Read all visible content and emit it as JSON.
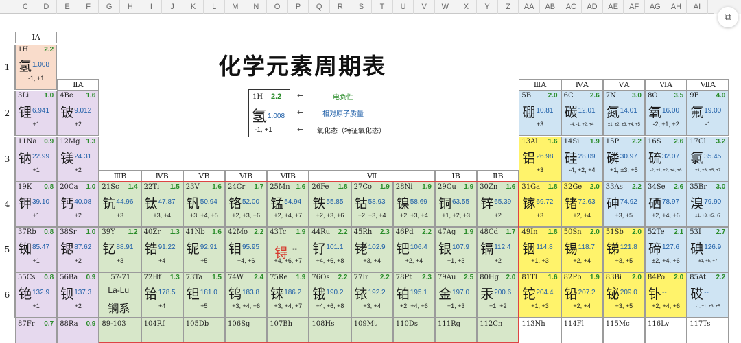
{
  "sheet": {
    "columns": [
      "C",
      "D",
      "E",
      "F",
      "G",
      "H",
      "I",
      "J",
      "K",
      "L",
      "M",
      "N",
      "O",
      "P",
      "Q",
      "R",
      "S",
      "T",
      "U",
      "V",
      "W",
      "X",
      "Y",
      "Z",
      "AA",
      "AB",
      "AC",
      "AD",
      "AE",
      "AF",
      "AG",
      "AH",
      "AI"
    ],
    "float_icon": "scan-icon"
  },
  "title": "化学元素周期表",
  "legend": {
    "zn": "1H",
    "en": "2.2",
    "cn": "氢",
    "mass": "1.008",
    "ox": "-1, +1",
    "label_en": "电负性",
    "label_mass": "相对原子质量",
    "label_ox": "氧化态（特征氧化态）",
    "colors": {
      "en": "#2a8c2a",
      "mass": "#1f5fa8"
    }
  },
  "groups": {
    "g1": "ⅠA",
    "g2": "ⅡA",
    "g3": "ⅢB",
    "g4": "ⅣB",
    "g5": "ⅤB",
    "g6": "ⅥB",
    "g7": "ⅦB",
    "g8": "Ⅶ",
    "g11": "ⅠB",
    "g12": "ⅡB",
    "g13": "ⅢA",
    "g14": "ⅣA",
    "g15": "ⅤA",
    "g16": "ⅥA",
    "g17": "ⅦA"
  },
  "periods": [
    "1",
    "2",
    "3",
    "4",
    "5",
    "6"
  ],
  "elements": [
    {
      "id": "H",
      "zn": "1H",
      "en": "2.2",
      "cn": "氢",
      "mass": "1.008",
      "ox": "-1, +1"
    },
    {
      "id": "Li",
      "zn": "3Li",
      "en": "1.0",
      "cn": "锂",
      "mass": "6.941",
      "ox": "+1"
    },
    {
      "id": "Be",
      "zn": "4Be",
      "en": "1.6",
      "cn": "铍",
      "mass": "9.012",
      "ox": "+2"
    },
    {
      "id": "Na",
      "zn": "11Na",
      "en": "0.9",
      "cn": "钠",
      "mass": "22.99",
      "ox": "+1"
    },
    {
      "id": "Mg",
      "zn": "12Mg",
      "en": "1.3",
      "cn": "镁",
      "mass": "24.31",
      "ox": "+2"
    },
    {
      "id": "K",
      "zn": "19K",
      "en": "0.8",
      "cn": "钾",
      "mass": "39.10",
      "ox": "+1"
    },
    {
      "id": "Ca",
      "zn": "20Ca",
      "en": "1.0",
      "cn": "钙",
      "mass": "40.08",
      "ox": "+2"
    },
    {
      "id": "Sc",
      "zn": "21Sc",
      "en": "1.4",
      "cn": "钪",
      "mass": "44.96",
      "ox": "+3"
    },
    {
      "id": "Ti",
      "zn": "22Ti",
      "en": "1.5",
      "cn": "钛",
      "mass": "47.87",
      "ox": "+3, +4"
    },
    {
      "id": "V",
      "zn": "23V",
      "en": "1.6",
      "cn": "钒",
      "mass": "50.94",
      "ox": "+3, +4, +5"
    },
    {
      "id": "Cr",
      "zn": "24Cr",
      "en": "1.7",
      "cn": "铬",
      "mass": "52.00",
      "ox": "+2, +3, +6"
    },
    {
      "id": "Mn",
      "zn": "25Mn",
      "en": "1.6",
      "cn": "锰",
      "mass": "54.94",
      "ox": "+2, +4, +7"
    },
    {
      "id": "Fe",
      "zn": "26Fe",
      "en": "1.8",
      "cn": "铁",
      "mass": "55.85",
      "ox": "+2, +3, +6"
    },
    {
      "id": "Co",
      "zn": "27Co",
      "en": "1.9",
      "cn": "钴",
      "mass": "58.93",
      "ox": "+2, +3, +4"
    },
    {
      "id": "Ni",
      "zn": "28Ni",
      "en": "1.9",
      "cn": "镍",
      "mass": "58.69",
      "ox": "+2, +3, +4"
    },
    {
      "id": "Cu",
      "zn": "29Cu",
      "en": "1.9",
      "cn": "铜",
      "mass": "63.55",
      "ox": "+1, +2, +3"
    },
    {
      "id": "Zn",
      "zn": "30Zn",
      "en": "1.6",
      "cn": "锌",
      "mass": "65.39",
      "ox": "+2"
    },
    {
      "id": "Rb",
      "zn": "37Rb",
      "en": "0.8",
      "cn": "铷",
      "mass": "85.47",
      "ox": "+1"
    },
    {
      "id": "Sr",
      "zn": "38Sr",
      "en": "1.0",
      "cn": "锶",
      "mass": "87.62",
      "ox": "+2"
    },
    {
      "id": "Y",
      "zn": "39Y",
      "en": "1.2",
      "cn": "钇",
      "mass": "88.91",
      "ox": "+3"
    },
    {
      "id": "Zr",
      "zn": "40Zr",
      "en": "1.3",
      "cn": "锆",
      "mass": "91.22",
      "ox": "+4"
    },
    {
      "id": "Nb",
      "zn": "41Nb",
      "en": "1.6",
      "cn": "铌",
      "mass": "92.91",
      "ox": "+5"
    },
    {
      "id": "Mo",
      "zn": "42Mo",
      "en": "2.2",
      "cn": "钼",
      "mass": "95.95",
      "ox": "+4, +6"
    },
    {
      "id": "Tc",
      "zn": "43Tc",
      "en": "1.9",
      "cn": "锝",
      "mass": "--",
      "ox": "+4, +6, +7"
    },
    {
      "id": "Ru",
      "zn": "44Ru",
      "en": "2.2",
      "cn": "钌",
      "mass": "101.1",
      "ox": "+4, +6, +8"
    },
    {
      "id": "Rh",
      "zn": "45Rh",
      "en": "2.3",
      "cn": "铑",
      "mass": "102.9",
      "ox": "+3, +4"
    },
    {
      "id": "Pd",
      "zn": "46Pd",
      "en": "2.2",
      "cn": "钯",
      "mass": "106.4",
      "ox": "+2, +4"
    },
    {
      "id": "Ag",
      "zn": "47Ag",
      "en": "1.9",
      "cn": "银",
      "mass": "107.9",
      "ox": "+1, +3"
    },
    {
      "id": "Cd",
      "zn": "48Cd",
      "en": "1.7",
      "cn": "镉",
      "mass": "112.4",
      "ox": "+2"
    },
    {
      "id": "Cs",
      "zn": "55Cs",
      "en": "0.8",
      "cn": "铯",
      "mass": "132.9",
      "ox": "+1"
    },
    {
      "id": "Ba",
      "zn": "56Ba",
      "en": "0.9",
      "cn": "钡",
      "mass": "137.3",
      "ox": "+2"
    },
    {
      "id": "La",
      "zn": "57-71",
      "en": "",
      "cn": "镧系",
      "mass": "La-Lu",
      "ox": ""
    },
    {
      "id": "Hf",
      "zn": "72Hf",
      "en": "1.3",
      "cn": "铪",
      "mass": "178.5",
      "ox": "+4"
    },
    {
      "id": "Ta",
      "zn": "73Ta",
      "en": "1.5",
      "cn": "钽",
      "mass": "181.0",
      "ox": "+5"
    },
    {
      "id": "W",
      "zn": "74W",
      "en": "2.4",
      "cn": "钨",
      "mass": "183.8",
      "ox": "+3, +4, +6"
    },
    {
      "id": "Re",
      "zn": "75Re",
      "en": "1.9",
      "cn": "铼",
      "mass": "186.2",
      "ox": "+3, +4, +7"
    },
    {
      "id": "Os",
      "zn": "76Os",
      "en": "2.2",
      "cn": "锇",
      "mass": "190.2",
      "ox": "+4, +6, +8"
    },
    {
      "id": "Ir",
      "zn": "77Ir",
      "en": "2.2",
      "cn": "铱",
      "mass": "192.2",
      "ox": "+3, +4"
    },
    {
      "id": "Pt",
      "zn": "78Pt",
      "en": "2.3",
      "cn": "铂",
      "mass": "195.1",
      "ox": "+2, +4, +6"
    },
    {
      "id": "Au",
      "zn": "79Au",
      "en": "2.5",
      "cn": "金",
      "mass": "197.0",
      "ox": "+1, +3"
    },
    {
      "id": "Hg",
      "zn": "80Hg",
      "en": "2.0",
      "cn": "汞",
      "mass": "200.6",
      "ox": "+1, +2"
    },
    {
      "id": "B",
      "zn": "5B",
      "en": "2.0",
      "cn": "硼",
      "mass": "10.81",
      "ox": "+3"
    },
    {
      "id": "C",
      "zn": "6C",
      "en": "2.6",
      "cn": "碳",
      "mass": "12.01",
      "ox": "-4, -1, +2, +4"
    },
    {
      "id": "N",
      "zn": "7N",
      "en": "3.0",
      "cn": "氮",
      "mass": "14.01",
      "ox": "±1, ±2, ±3, +4, +5"
    },
    {
      "id": "O",
      "zn": "8O",
      "en": "3.5",
      "cn": "氧",
      "mass": "16.00",
      "ox": "-2, ±1, +2"
    },
    {
      "id": "F",
      "zn": "9F",
      "en": "4.0",
      "cn": "氟",
      "mass": "19.00",
      "ox": "-1"
    },
    {
      "id": "Al",
      "zn": "13Al",
      "en": "1.6",
      "cn": "铝",
      "mass": "26.98",
      "ox": "+3"
    },
    {
      "id": "Si",
      "zn": "14Si",
      "en": "1.9",
      "cn": "硅",
      "mass": "28.09",
      "ox": "-4, +2, +4"
    },
    {
      "id": "P",
      "zn": "15P",
      "en": "2.2",
      "cn": "磷",
      "mass": "30.97",
      "ox": "+1, ±3, +5"
    },
    {
      "id": "S",
      "zn": "16S",
      "en": "2.6",
      "cn": "硫",
      "mass": "32.07",
      "ox": "-2, ±1, +2, +4, +6"
    },
    {
      "id": "Cl",
      "zn": "17Cl",
      "en": "3.2",
      "cn": "氯",
      "mass": "35.45",
      "ox": "±1, +3, +5, +7"
    },
    {
      "id": "Ga",
      "zn": "31Ga",
      "en": "1.8",
      "cn": "镓",
      "mass": "69.72",
      "ox": "+3"
    },
    {
      "id": "Ge",
      "zn": "32Ge",
      "en": "2.0",
      "cn": "锗",
      "mass": "72.63",
      "ox": "+2, +4"
    },
    {
      "id": "As",
      "zn": "33As",
      "en": "2.2",
      "cn": "砷",
      "mass": "74.92",
      "ox": "±3, +5"
    },
    {
      "id": "Se",
      "zn": "34Se",
      "en": "2.6",
      "cn": "硒",
      "mass": "78.97",
      "ox": "±2, +4, +6"
    },
    {
      "id": "Br",
      "zn": "35Br",
      "en": "3.0",
      "cn": "溴",
      "mass": "79.90",
      "ox": "±1, +3, +5, +7"
    },
    {
      "id": "In",
      "zn": "49In",
      "en": "1.8",
      "cn": "铟",
      "mass": "114.8",
      "ox": "+1, +3"
    },
    {
      "id": "Sn",
      "zn": "50Sn",
      "en": "2.0",
      "cn": "锡",
      "mass": "118.7",
      "ox": "+2, +4"
    },
    {
      "id": "Sb",
      "zn": "51Sb",
      "en": "2.0",
      "cn": "锑",
      "mass": "121.8",
      "ox": "+3, +5"
    },
    {
      "id": "Te",
      "zn": "52Te",
      "en": "2.1",
      "cn": "碲",
      "mass": "127.6",
      "ox": "±2, +4, +6"
    },
    {
      "id": "I",
      "zn": "53I",
      "en": "2.7",
      "cn": "碘",
      "mass": "126.9",
      "ox": "±1, +5, +7"
    },
    {
      "id": "Tl",
      "zn": "81Tl",
      "en": "1.6",
      "cn": "铊",
      "mass": "204.4",
      "ox": "+1, +3"
    },
    {
      "id": "Pb",
      "zn": "82Pb",
      "en": "1.9",
      "cn": "铅",
      "mass": "207.2",
      "ox": "+2, +4"
    },
    {
      "id": "Bi",
      "zn": "83Bi",
      "en": "2.0",
      "cn": "铋",
      "mass": "209.0",
      "ox": "+3, +5"
    },
    {
      "id": "Po",
      "zn": "84Po",
      "en": "2.0",
      "cn": "钋",
      "mass": "--",
      "ox": "+2, +4, +6"
    },
    {
      "id": "At",
      "zn": "85At",
      "en": "2.2",
      "cn": "砹",
      "mass": "--",
      "ox": "-1, +1, +3, +5"
    }
  ],
  "row7": [
    {
      "id": "Fr",
      "text": "87Fr",
      "en": "0.7"
    },
    {
      "id": "Ra",
      "text": "88Ra",
      "en": "0.9"
    },
    {
      "id": "Ac",
      "text": "89-103",
      "en": ""
    },
    {
      "id": "Rf",
      "text": "104Rf",
      "en": "–"
    },
    {
      "id": "Db",
      "text": "105Db",
      "en": "–"
    },
    {
      "id": "Sg",
      "text": "106Sg",
      "en": "–"
    },
    {
      "id": "Bh",
      "text": "107Bh",
      "en": "–"
    },
    {
      "id": "Hs",
      "text": "108Hs",
      "en": "–"
    },
    {
      "id": "Mt",
      "text": "109Mt",
      "en": "–"
    },
    {
      "id": "Ds",
      "text": "110Ds",
      "en": "–"
    },
    {
      "id": "Rg",
      "text": "111Rg",
      "en": "–"
    },
    {
      "id": "Cn",
      "text": "112Cn",
      "en": "–"
    },
    {
      "id": "Nh",
      "text": "113Nh",
      "en": ""
    },
    {
      "id": "Fl",
      "text": "114Fl",
      "en": ""
    },
    {
      "id": "Mc",
      "text": "115Mc",
      "en": ""
    },
    {
      "id": "Lv",
      "text": "116Lv",
      "en": ""
    },
    {
      "id": "Ts",
      "text": "117Ts",
      "en": ""
    }
  ]
}
